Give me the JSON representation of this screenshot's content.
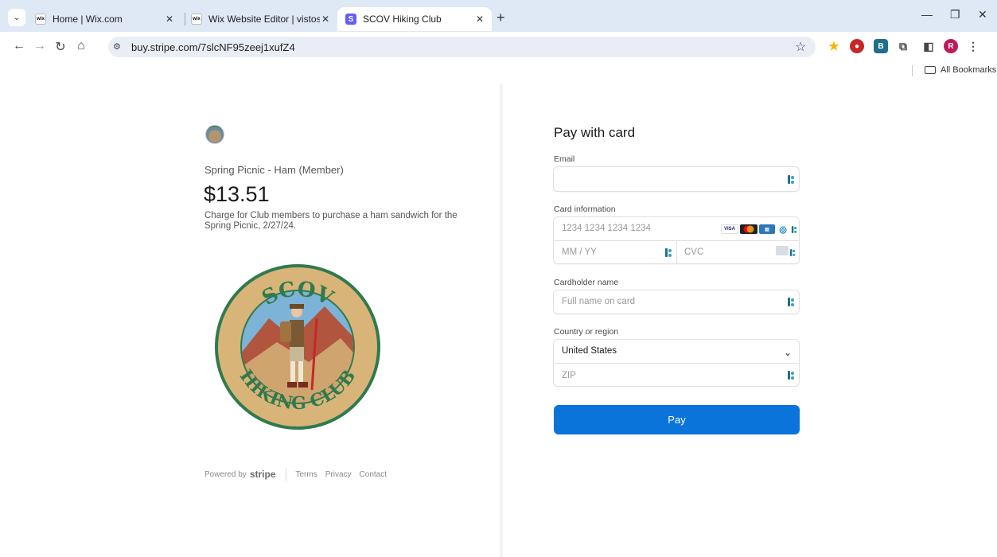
{
  "browser": {
    "tabs": [
      {
        "label": "Home | Wix.com",
        "favicon": "wix"
      },
      {
        "label": "Wix Website Editor | vistosohiki",
        "favicon": "wix"
      },
      {
        "label": "SCOV Hiking Club",
        "favicon": "S"
      }
    ],
    "wix_favicon_text": "wix",
    "url": "buy.stripe.com/7slcNF95zeej1xufZ4",
    "bookmarks_label": "All Bookmarks",
    "profile_initial": "R",
    "extension_badge": "B",
    "accent_color": "#0a74da"
  },
  "product": {
    "name": "Spring Picnic - Ham (Member)",
    "price": "$13.51",
    "description": "Charge for Club members to purchase a ham sandwich for the Spring Picnic, 2/27/24.",
    "badge_top_text": "SCOV",
    "badge_bottom_text": "HIKING CLUB"
  },
  "footer": {
    "powered_by": "Powered by",
    "brand": "stripe",
    "links": [
      "Terms",
      "Privacy",
      "Contact"
    ]
  },
  "form": {
    "title": "Pay with card",
    "email_label": "Email",
    "email_value": "",
    "card_label": "Card information",
    "card_number_placeholder": "1234 1234 1234 1234",
    "expiry_placeholder": "MM / YY",
    "cvc_placeholder": "CVC",
    "card_brands": [
      "VISA",
      "mastercard",
      "amex",
      "diners"
    ],
    "cardholder_label": "Cardholder name",
    "cardholder_placeholder": "Full name on card",
    "country_label": "Country or region",
    "country_value": "United States",
    "zip_placeholder": "ZIP",
    "pay_label": "Pay"
  }
}
